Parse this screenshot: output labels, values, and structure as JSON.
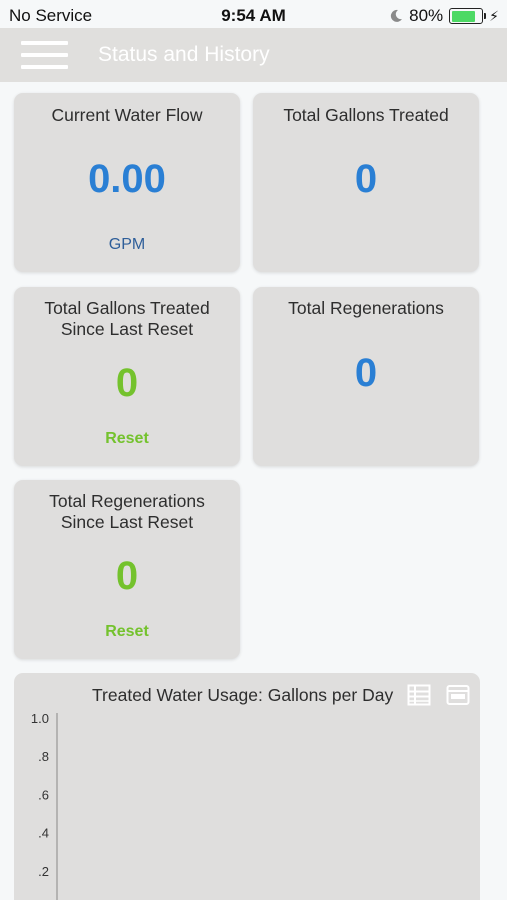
{
  "status_bar": {
    "carrier": "No Service",
    "time": "9:54 AM",
    "battery": "80%",
    "battery_level": 0.8
  },
  "nav": {
    "title": "Status and History",
    "menu_icon": "hamburger-menu-icon"
  },
  "cards": {
    "water_flow": {
      "title": "Current Water Flow",
      "value": "0.00",
      "unit": "GPM"
    },
    "gallons_treated": {
      "title": "Total Gallons Treated",
      "value": "0"
    },
    "gallons_since_reset": {
      "title_line1": "Total Gallons Treated",
      "title_line2": "Since Last Reset",
      "value": "0",
      "reset_label": "Reset"
    },
    "regenerations": {
      "title": "Total Regenerations",
      "value": "0"
    },
    "regenerations_since_reset": {
      "title_line1": "Total Regenerations",
      "title_line2": "Since Last Reset",
      "value": "0",
      "reset_label": "Reset"
    }
  },
  "colors": {
    "value_blue": "#2a7fd4",
    "value_green": "#74c22d",
    "card_bg": "#dfdedd",
    "nav_bg": "#e0dfdd"
  },
  "chart_data": {
    "type": "bar",
    "title": "Treated Water Usage: Gallons per Day",
    "xlabel": "",
    "ylabel": "",
    "ylim": [
      0,
      1.0
    ],
    "y_ticks": [
      "1.0",
      ".8",
      ".6",
      ".4",
      ".2"
    ],
    "y_tick_values": [
      1.0,
      0.8,
      0.6,
      0.4,
      0.2
    ],
    "categories": [],
    "values": [],
    "icons": [
      "table-view-icon",
      "export-csv-icon"
    ]
  }
}
